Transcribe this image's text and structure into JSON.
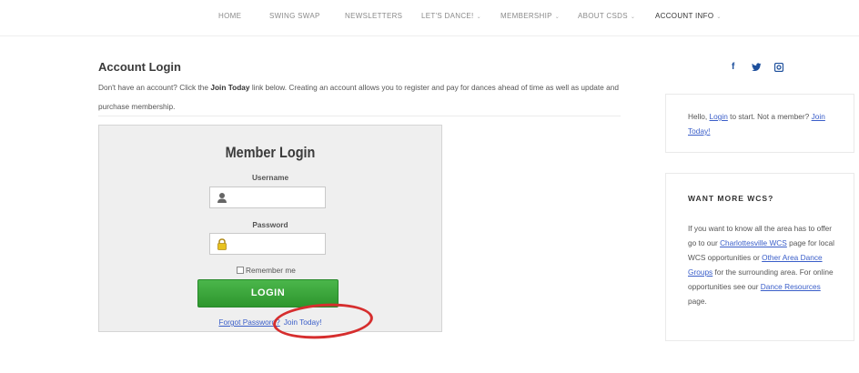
{
  "nav": {
    "items": [
      {
        "label": "HOME",
        "caret": ""
      },
      {
        "label": "SWING SWAP",
        "caret": ""
      },
      {
        "label": "NEWSLETTERS",
        "caret": ""
      },
      {
        "label": "LET'S DANCE!",
        "caret": "⌄"
      },
      {
        "label": "MEMBERSHIP",
        "caret": "⌄"
      },
      {
        "label": "ABOUT CSDS",
        "caret": "⌄"
      },
      {
        "label": "ACCOUNT INFO",
        "caret": "⌄"
      }
    ]
  },
  "main": {
    "title": "Account Login",
    "intro_pre": "Don't have an account?  Click the ",
    "intro_bold": "Join Today",
    "intro_post": " link below.  Creating an account allows you to register and pay for dances ahead of time as well as update and purchase membership."
  },
  "login": {
    "title": "Member Login",
    "username_label": "Username",
    "username_value": "",
    "password_label": "Password",
    "password_value": "",
    "remember_label": "Remember me",
    "button_label": "LOGIN",
    "forgot_label": "Forgot Password?",
    "join_label": "Join Today!"
  },
  "sidebar": {
    "social": {
      "facebook": "f",
      "twitter": "🐦",
      "instagram": "◙"
    },
    "hello_pre": "Hello, ",
    "login_link": "Login",
    "hello_post": " to start. Not a member? ",
    "join_link": "Join Today!",
    "wcs_heading": "WANT MORE WCS?",
    "wcs_1": "If you want to know all the area has to offer go to our ",
    "wcs_link1": "Charlottesville WCS",
    "wcs_2": " page for local WCS opportunities or ",
    "wcs_link2": "Other Area Dance Groups",
    "wcs_3": " for the surrounding area.  For online opportunities see our ",
    "wcs_link3": "Dance Resources",
    "wcs_4": " page."
  },
  "colors": {
    "link": "#3a5ec9",
    "login_button": "#3aa83a",
    "annotation_oval": "#d62e2e",
    "social": "#1d4f9c"
  }
}
